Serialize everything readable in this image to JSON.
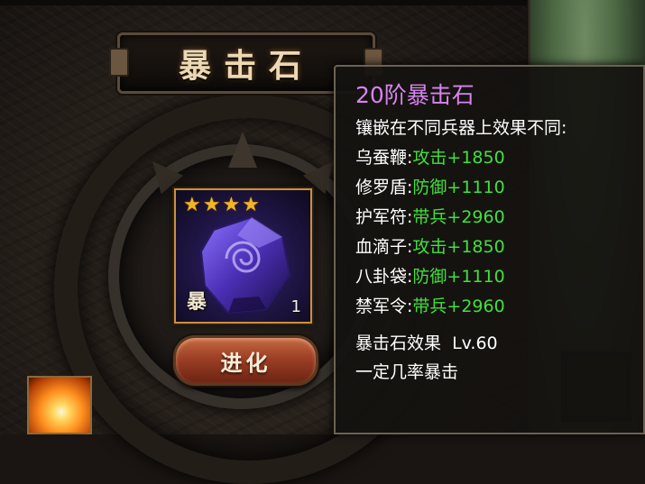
{
  "panel": {
    "title": "暴击石"
  },
  "item": {
    "stars": 4,
    "badge_char": "暴",
    "count": "1",
    "gem_color": "#5b3fc2"
  },
  "evolve_button": {
    "label": "进化"
  },
  "tooltip": {
    "title": "20阶暴击石",
    "subtitle": "镶嵌在不同兵器上效果不同:",
    "rows": [
      {
        "weapon": "乌蚕鞭:",
        "effect": "攻击+1850"
      },
      {
        "weapon": "修罗盾:",
        "effect": "防御+1110"
      },
      {
        "weapon": "护军符:",
        "effect": "带兵+2960"
      },
      {
        "weapon": "血滴子:",
        "effect": "攻击+1850"
      },
      {
        "weapon": "八卦袋:",
        "effect": "防御+1110"
      },
      {
        "weapon": "禁军令:",
        "effect": "带兵+2960"
      }
    ],
    "effect_title": "暴击石效果",
    "effect_level": "Lv.60",
    "effect_desc": "一定几率暴击"
  },
  "colors": {
    "title_purple": "#d783ee",
    "value_green": "#42e03c",
    "card_border": "#c9913e",
    "star_gold": "#f2b526"
  }
}
